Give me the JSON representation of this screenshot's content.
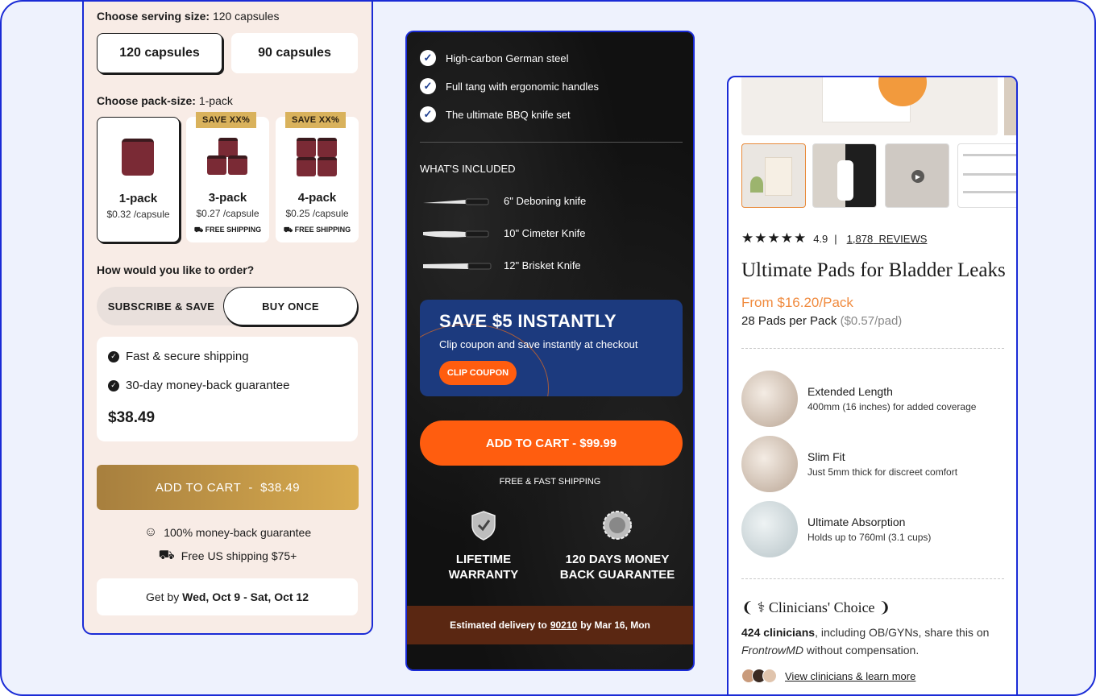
{
  "panel1": {
    "serving_label": "Choose serving size:",
    "serving_value": "120 capsules",
    "serving_options": [
      "120 capsules",
      "90 capsules"
    ],
    "pack_label": "Choose pack-size:",
    "pack_value": "1-pack",
    "packs": [
      {
        "name": "1-pack",
        "price": "$0.32 /capsule",
        "badge": "",
        "shipping": ""
      },
      {
        "name": "3-pack",
        "price": "$0.27 /capsule",
        "badge": "SAVE XX%",
        "shipping": "FREE SHIPPING"
      },
      {
        "name": "4-pack",
        "price": "$0.25 /capsule",
        "badge": "SAVE XX%",
        "shipping": "FREE SHIPPING"
      }
    ],
    "order_label": "How would you like to order?",
    "subscribe_label": "SUBSCRIBE & SAVE",
    "buy_once_label": "BUY ONCE",
    "benefits": [
      "Fast & secure shipping",
      "30-day money-back guarantee"
    ],
    "price": "$38.49",
    "add_to_cart": "ADD TO CART  -  $38.49",
    "guarantee": "100% money-back guarantee",
    "shipping_note": "Free US shipping $75+",
    "get_by_prefix": "Get by",
    "get_by_dates": "Wed, Oct 9 - Sat, Oct 12"
  },
  "panel2": {
    "features": [
      "High-carbon German steel",
      "Full tang with ergonomic handles",
      "The ultimate BBQ knife set"
    ],
    "whats_included": "WHAT'S INCLUDED",
    "knives": [
      "6\" Deboning knife",
      "10\" Cimeter Knife",
      "12\" Brisket Knife"
    ],
    "coupon_title": "SAVE $5 INSTANTLY",
    "coupon_sub": "Clip coupon and save instantly at checkout",
    "coupon_button": "CLIP COUPON",
    "add_to_cart": "ADD TO CART - $99.99",
    "shipping": "FREE & FAST SHIPPING",
    "guarantee_left_1": "LIFETIME",
    "guarantee_left_2": "WARRANTY",
    "guarantee_right_1": "120 DAYS MONEY",
    "guarantee_right_2": "BACK GUARANTEE",
    "delivery_prefix": "Estimated delivery to",
    "delivery_zip": "90210",
    "delivery_suffix": "by Mar 16, Mon",
    "colors": {
      "accent": "#ff5d0f",
      "coupon_bg": "#1c3a7e",
      "delivery_bg": "#5a2712"
    }
  },
  "panel3": {
    "rating": "4.9",
    "separator": "|",
    "reviews_count": "1,878",
    "reviews_label": "REVIEWS",
    "title": "Ultimate Pads for Bladder Leaks",
    "from_price": "From $16.20/Pack",
    "pack_info": "28 Pads per Pack",
    "per_pad": "($0.57/pad)",
    "features": [
      {
        "title": "Extended Length",
        "desc": "400mm (16 inches) for added coverage"
      },
      {
        "title": "Slim Fit",
        "desc": "Just 5mm thick for discreet comfort"
      },
      {
        "title": "Ultimate Absorption",
        "desc": "Holds up to 760ml (3.1 cups)"
      }
    ],
    "clinicians_title": "Clinicians' Choice",
    "clinicians_count": "424 clinicians",
    "clinicians_text": ", including OB/GYNs, share this on",
    "clinicians_brand": "FrontrowMD",
    "clinicians_text2": " without compensation.",
    "view_link": "View clinicians & learn more",
    "colors": {
      "accent": "#f08b3f"
    }
  }
}
